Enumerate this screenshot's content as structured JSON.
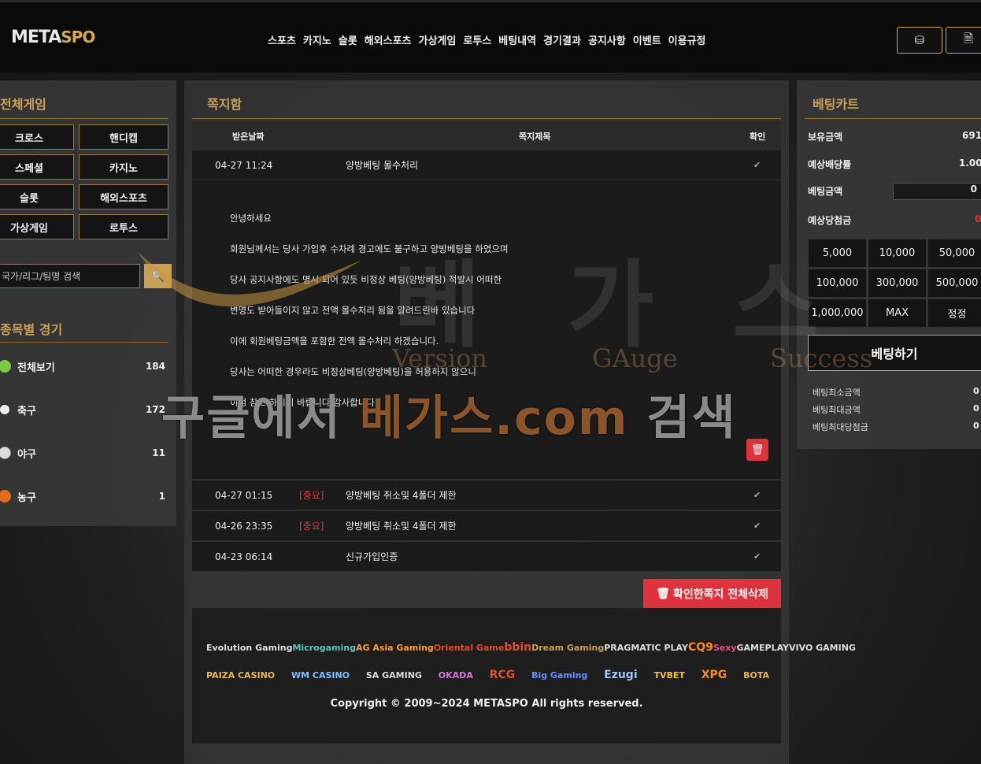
{
  "header": {
    "logo_meta": "META",
    "logo_spo": "SPO",
    "nav": [
      "스포츠",
      "카지노",
      "슬롯",
      "해외스포츠",
      "가상게임",
      "로투스",
      "베팅내역",
      "경기결과",
      "공지사항",
      "이벤트",
      "이용규정"
    ]
  },
  "left": {
    "title": "전체게임",
    "games": [
      "크로스",
      "핸디캡",
      "스페셜",
      "카지노",
      "슬롯",
      "해외스포츠",
      "가상게임",
      "로투스"
    ],
    "search_placeholder": "국가/리그/팀명 검색",
    "sports_title": "종목별 경기",
    "sports": [
      {
        "name": "전체보기",
        "count": "184"
      },
      {
        "name": "축구",
        "count": "172"
      },
      {
        "name": "야구",
        "count": "11"
      },
      {
        "name": "농구",
        "count": "1"
      }
    ]
  },
  "center": {
    "title": "쪽지함",
    "columns": {
      "date": "받은날짜",
      "subject": "쪽지제목",
      "check": "확인"
    },
    "opened": {
      "date": "04-27 11:24",
      "subject": "양방베팅 몰수처리"
    },
    "body": [
      "안녕하세요",
      "회원님께서는 당사 가입후 수차례 경고에도 불구하고 양방베팅을 하였으며",
      "당사 공지사항에도 명시 되어 있듯 비정상 베팅(양방베팅) 적발시 어떠한",
      "변명도 받아들이지 않고 전액 몰수처리 됨을 알려드린바 있습니다",
      "이에 회원베팅금액을 포함한 전액 몰수처리 하겠습니다.",
      "당사는 어떠한 경우라도 비정상베팅(양방베팅)을 허용하지 않으니",
      "이점 참고 하시기 바랍니다 감사합니다."
    ],
    "messages": [
      {
        "date": "04-27 01:15",
        "tag": "[중요]",
        "subject": "양방베팅 취소및 4폴더 제한"
      },
      {
        "date": "04-26 23:35",
        "tag": "[중요]",
        "subject": "양방베팅 취소및 4폴더 제한"
      },
      {
        "date": "04-23 06:14",
        "tag": "",
        "subject": "신규가입인증"
      }
    ],
    "delete_all": "확인한쪽지 전체삭제"
  },
  "footer": {
    "providers_row1": [
      "Evolution Gaming",
      "Microgaming",
      "AG Asia Gaming",
      "Oriental Game",
      "bbin",
      "Dream Gaming",
      "PRAGMATIC PLAY",
      "CQ9",
      "Sexy",
      "GAMEPLAY",
      "VIVO GAMING"
    ],
    "providers_row2": [
      "PAIZA CASINO",
      "WM CASINO",
      "SA GAMING",
      "OKADA",
      "RCG",
      "Big Gaming",
      "Ezugi",
      "TVBET",
      "XPG",
      "BOTA"
    ],
    "copyright": "Copyright © 2009~2024 METASPO All rights reserved."
  },
  "right": {
    "title": "베팅카트",
    "balance_label": "보유금액",
    "balance_value": "691",
    "odds_label": "예상배당률",
    "odds_value": "1.00",
    "bet_amount_label": "베팅금액",
    "bet_amount_value": "0",
    "expected_label": "예상당첨금",
    "expected_value": "0",
    "amounts": [
      "5,000",
      "10,000",
      "50,000",
      "100,000",
      "300,000",
      "500,000",
      "1,000,000",
      "MAX",
      "정정"
    ],
    "bet_button": "베팅하기",
    "limits": [
      {
        "label": "베팅최소금액",
        "value": "0"
      },
      {
        "label": "베팅최대금액",
        "value": "0"
      },
      {
        "label": "베팅최대당첨금",
        "value": "0"
      }
    ]
  },
  "watermark": {
    "big_prefix": "구글에서 ",
    "big_brand": "베가스.com",
    "big_suffix": " 검색",
    "ghost": [
      "베",
      "가",
      "스"
    ],
    "sub": [
      "Version",
      "GAuge",
      "Success"
    ]
  },
  "colors": {
    "accent_gold": "#c9a05a",
    "danger": "#e0323c"
  }
}
